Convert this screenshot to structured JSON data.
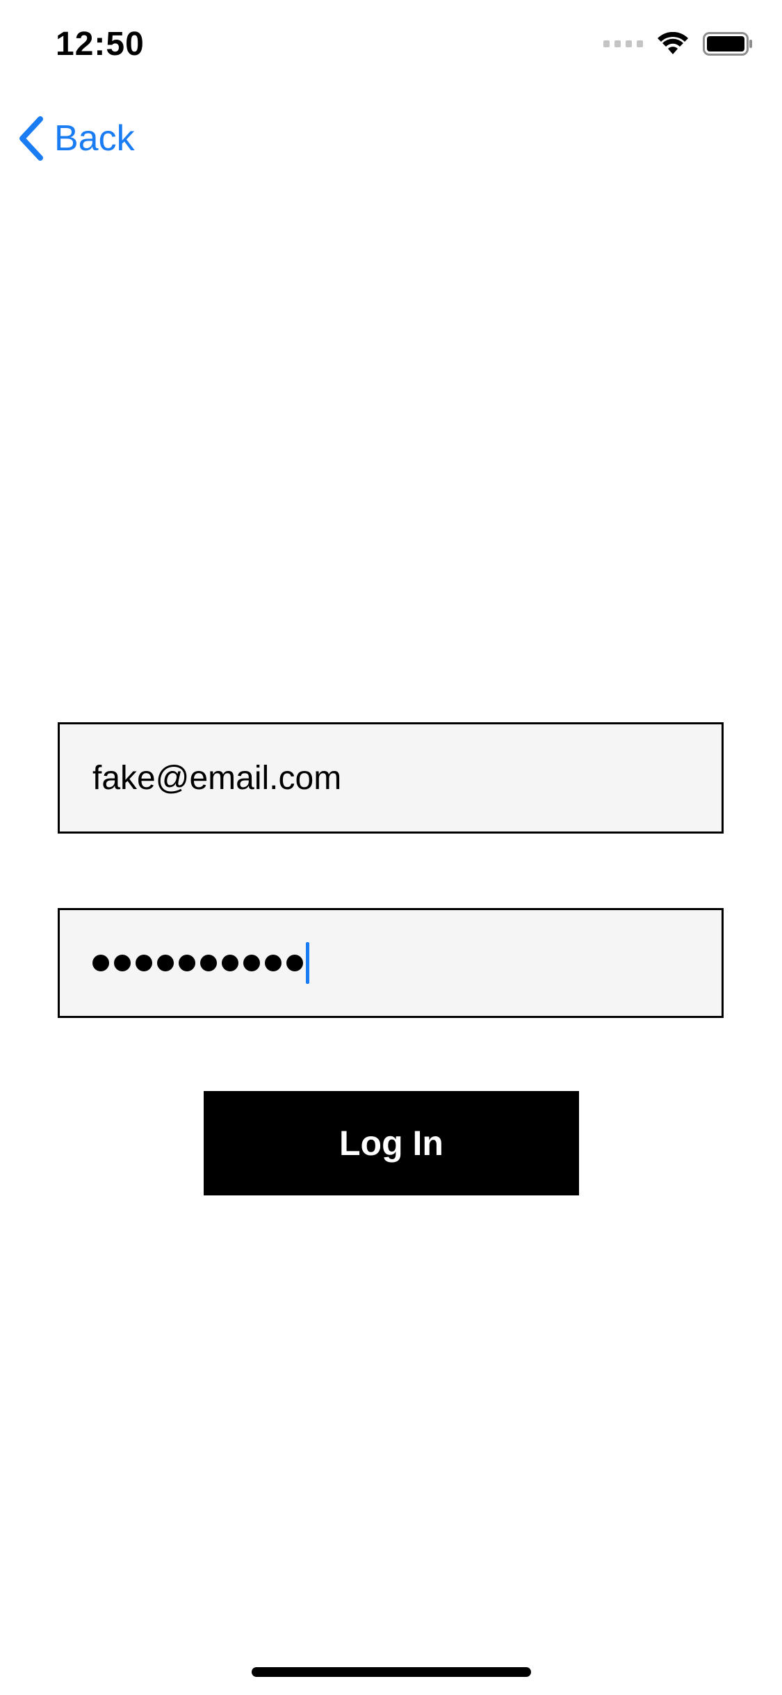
{
  "status_bar": {
    "time": "12:50",
    "icons": [
      "signal-icon",
      "wifi-icon",
      "battery-icon"
    ]
  },
  "nav": {
    "back_label": "Back",
    "back_icon": "chevron-left-icon",
    "accent_color": "#1a7cf2"
  },
  "form": {
    "email_value": "fake@email.com",
    "password_mask_count": 10,
    "field_background": "#f5f5f5",
    "login_label": "Log In",
    "button_color": "#000000"
  }
}
